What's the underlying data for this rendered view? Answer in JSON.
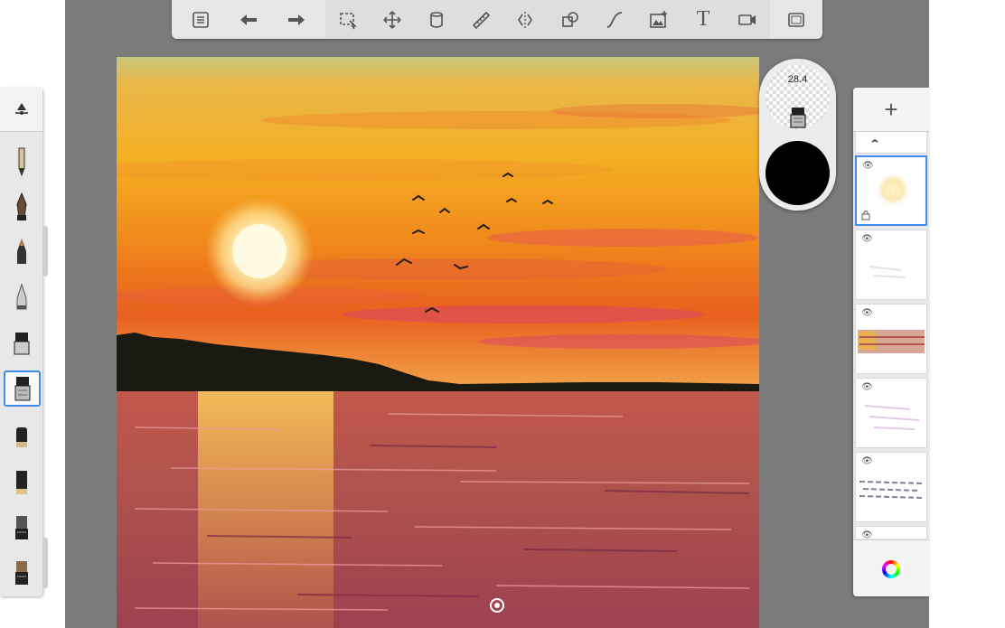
{
  "app": {
    "name": "sketch-painting-app"
  },
  "toolbar": {
    "left_tools": [
      {
        "name": "brush-library-icon"
      },
      {
        "name": "undo-icon"
      },
      {
        "name": "redo-icon"
      }
    ],
    "center_tools": [
      {
        "name": "selection-icon"
      },
      {
        "name": "transform-icon"
      },
      {
        "name": "fill-bucket-icon"
      },
      {
        "name": "ruler-icon"
      },
      {
        "name": "symmetry-icon"
      },
      {
        "name": "shapes-icon"
      },
      {
        "name": "curve-icon"
      },
      {
        "name": "add-image-icon"
      },
      {
        "name": "text-icon",
        "glyph": "T"
      },
      {
        "name": "record-icon"
      }
    ],
    "right_tools": [
      {
        "name": "fullscreen-icon"
      }
    ]
  },
  "puck": {
    "brush_size": "28.4",
    "color": "#000000"
  },
  "brushes": [
    {
      "name": "pencil-brush-icon",
      "selected": false
    },
    {
      "name": "ink-pen-brush-icon",
      "selected": false
    },
    {
      "name": "marker-brush-icon",
      "selected": false
    },
    {
      "name": "airbrush-brush-icon",
      "selected": false
    },
    {
      "name": "paint-brush-icon",
      "selected": false
    },
    {
      "name": "smudge-brush-icon",
      "selected": true
    },
    {
      "name": "eraser-brush-icon",
      "selected": false
    },
    {
      "name": "flat-brush-icon",
      "selected": false
    },
    {
      "name": "chisel-brush-icon",
      "selected": false
    },
    {
      "name": "texture-brush-icon",
      "selected": false
    }
  ],
  "layers": [
    {
      "name": "layer-birds",
      "selected": false,
      "locked": false
    },
    {
      "name": "layer-sun-glow",
      "selected": true,
      "locked": true
    },
    {
      "name": "layer-faint-strokes",
      "selected": false,
      "locked": false
    },
    {
      "name": "layer-red-sky",
      "selected": false,
      "locked": false
    },
    {
      "name": "layer-purple-strokes",
      "selected": false,
      "locked": false
    },
    {
      "name": "layer-water-lines",
      "selected": false,
      "locked": false
    },
    {
      "name": "layer-bottom",
      "selected": false,
      "locked": false
    }
  ],
  "colors": {
    "accent": "#3e8de8",
    "workspace": "#7b7b7b",
    "panel": "#e8e8e8"
  }
}
